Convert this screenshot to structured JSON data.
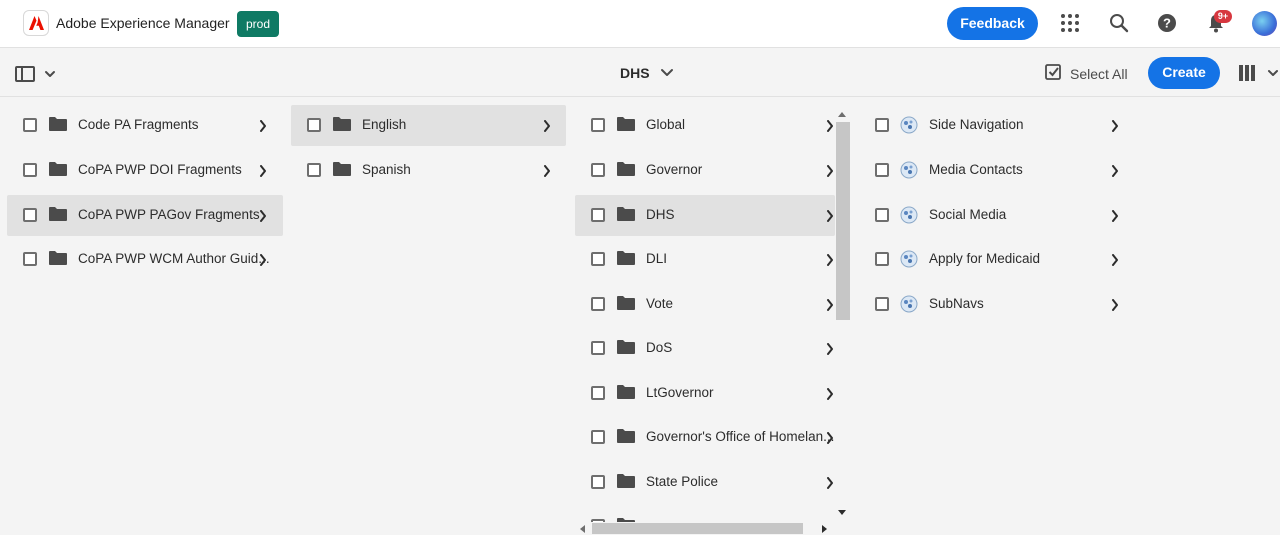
{
  "shell": {
    "app_name": "Adobe Experience Manager",
    "environment": "prod",
    "feedback_label": "Feedback",
    "notification_count": "9+",
    "icons": [
      "adobe-logo-icon",
      "apps-grid-icon",
      "search-icon",
      "help-icon",
      "bell-icon",
      "user-avatar"
    ]
  },
  "actionbar": {
    "title": "DHS",
    "select_all_label": "Select All",
    "create_label": "Create",
    "icons": [
      "rail-toggle-icon",
      "chevron-down-icon",
      "select-all-icon",
      "column-view-icon"
    ]
  },
  "columns": {
    "col1": [
      {
        "label": "Code PA Fragments",
        "selected": false
      },
      {
        "label": "CoPA PWP DOI Fragments",
        "selected": false
      },
      {
        "label": "CoPA PWP PAGov Fragments",
        "selected": true
      },
      {
        "label": "CoPA PWP WCM Author Guid...",
        "selected": false
      }
    ],
    "col2": [
      {
        "label": "English",
        "selected": true
      },
      {
        "label": "Spanish",
        "selected": false
      }
    ],
    "col3": [
      {
        "label": "Global",
        "selected": false
      },
      {
        "label": "Governor",
        "selected": false
      },
      {
        "label": "DHS",
        "selected": true
      },
      {
        "label": "DLI",
        "selected": false
      },
      {
        "label": "Vote",
        "selected": false
      },
      {
        "label": "DoS",
        "selected": false
      },
      {
        "label": "LtGovernor",
        "selected": false
      },
      {
        "label": "Governor's Office of Homelan...",
        "selected": false
      },
      {
        "label": "State Police",
        "selected": false
      }
    ],
    "col4": [
      {
        "label": "Side Navigation",
        "type": "fragment"
      },
      {
        "label": "Media Contacts",
        "type": "fragment"
      },
      {
        "label": "Social Media",
        "type": "fragment"
      },
      {
        "label": "Apply for Medicaid",
        "type": "fragment"
      },
      {
        "label": "SubNavs",
        "type": "fragment"
      }
    ]
  },
  "colors": {
    "accent": "#1473e6",
    "env_badge": "#0f7a64",
    "selected_row": "#e1e1e1",
    "notification": "#d7373f"
  }
}
